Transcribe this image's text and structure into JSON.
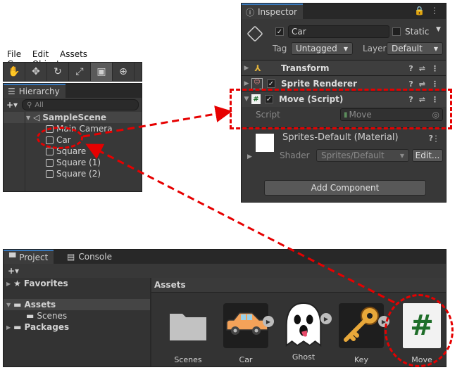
{
  "menu": [
    "File",
    "Edit",
    "Assets",
    "GameObject"
  ],
  "toolbar": {
    "tools": [
      "hand-icon",
      "move-icon",
      "rotate-icon",
      "scale-icon",
      "rect-icon",
      "transform-icon"
    ]
  },
  "hierarchy": {
    "tab": "Hierarchy",
    "add": "+▾",
    "search_placeholder": "All",
    "scene": "SampleScene",
    "items": [
      "Main Camera",
      "Car",
      "Square",
      "Square (1)",
      "Square (2)"
    ]
  },
  "inspector": {
    "tab": "Inspector",
    "name": "Car",
    "static_label": "Static",
    "tag_label": "Tag",
    "tag_value": "Untagged",
    "layer_label": "Layer",
    "layer_value": "Default",
    "components": [
      "Transform",
      "Sprite Renderer",
      "Move (Script)"
    ],
    "script_label": "Script",
    "script_value": "Move",
    "material_name": "Sprites-Default (Material)",
    "shader_label": "Shader",
    "shader_value": "Sprites/Default",
    "edit_label": "Edit...",
    "add_component": "Add Component"
  },
  "project": {
    "tabs": [
      "Project",
      "Console"
    ],
    "add": "+▾",
    "favorites": "Favorites",
    "assets": "Assets",
    "scenes": "Scenes",
    "packages": "Packages",
    "breadcrumb": "Assets",
    "items": [
      "Scenes",
      "Car",
      "Ghost",
      "Key",
      "Move"
    ]
  },
  "colors": {
    "highlight": "#e60000",
    "selection": "#2c5d87",
    "script_icon": "#1f6e2a"
  }
}
